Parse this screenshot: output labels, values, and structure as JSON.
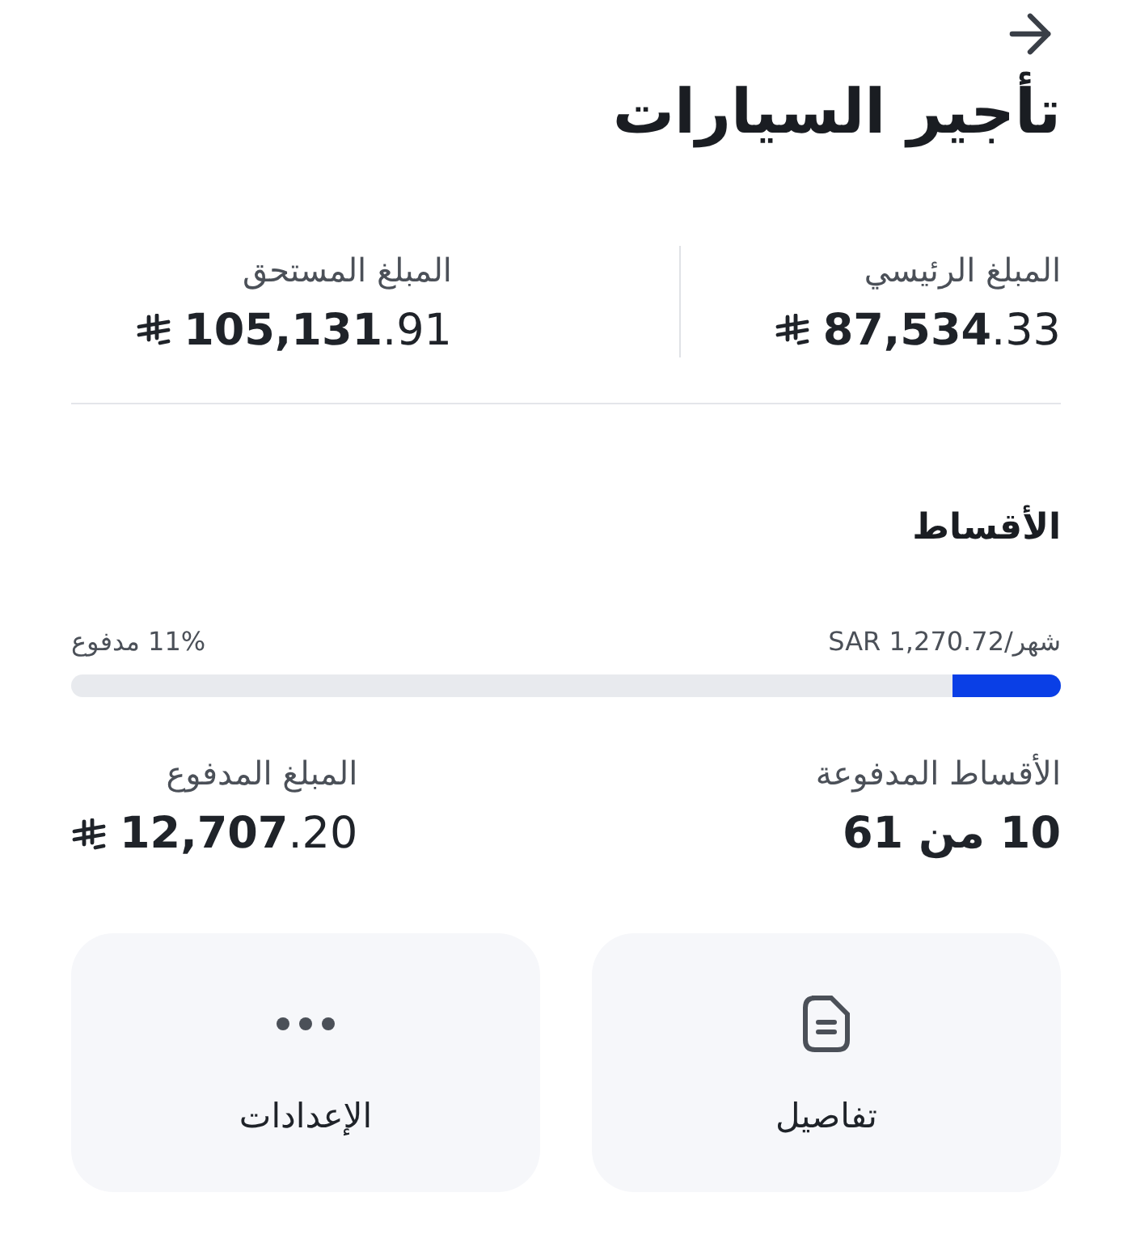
{
  "title": "تأجير السيارات",
  "summary": [
    {
      "label": "المبلغ الرئيسي",
      "amount": "**87,534**.33"
    },
    {
      "label": "المبلغ المستحق",
      "amount": "**105,131**.91"
    }
  ],
  "installments": {
    "heading": "الأقساط",
    "monthly": "شهر/SAR 1,270.72",
    "paid_percent": "11% مدفوع",
    "level": 0.11,
    "stats": [
      {
        "label": "الأقساط المدفوعة",
        "value": "10 من 61",
        "kind": "count"
      },
      {
        "label": "المبلغ المدفوع",
        "value": "**12,707**.20",
        "kind": "money"
      }
    ]
  },
  "actions": [
    {
      "label": "تفاصيل",
      "kind": "details"
    },
    {
      "label": "الإعدادات",
      "kind": "more"
    }
  ]
}
